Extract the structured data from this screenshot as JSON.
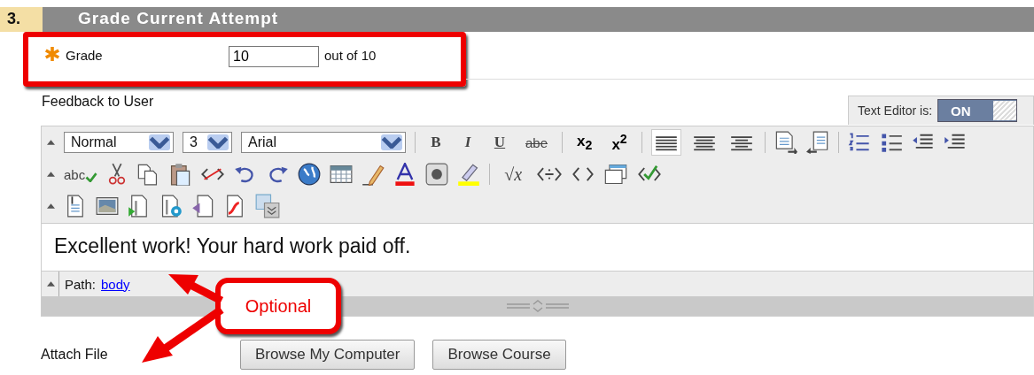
{
  "section": {
    "number": "3.",
    "title": "Grade Current Attempt"
  },
  "grade": {
    "label": "Grade",
    "required": true,
    "value": "10",
    "suffix": "out of 10"
  },
  "feedback": {
    "label": "Feedback to User"
  },
  "text_editor": {
    "label": "Text Editor is:",
    "state": "ON",
    "on": true
  },
  "toolbar": {
    "format": "Normal",
    "size": "3",
    "font": "Arial",
    "bold": "B",
    "italic": "I",
    "underline": "U",
    "strike": "abe",
    "subscript": "x$_{2}$",
    "superscript": "x$^{2}$",
    "spell": "abc",
    "math": "√x",
    "alignment": [
      {
        "selected": true
      },
      {
        "selected": false
      },
      {
        "selected": false
      }
    ]
  },
  "editor": {
    "content": "Excellent work! Your hard work paid off.",
    "path_label": "Path:",
    "path_link": "body"
  },
  "callout": {
    "label": "Optional"
  },
  "attach": {
    "label": "Attach File",
    "buttons": [
      "Browse My Computer",
      "Browse Course"
    ]
  }
}
